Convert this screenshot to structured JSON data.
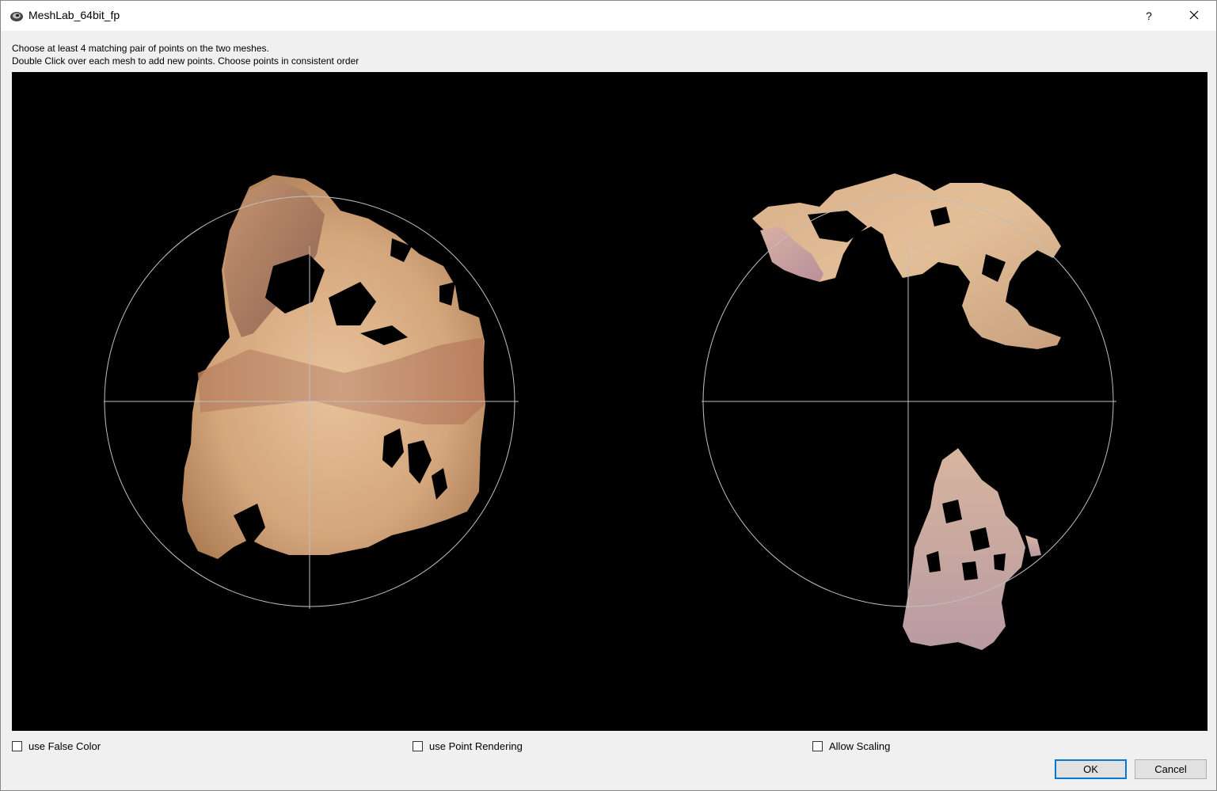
{
  "window": {
    "title": "MeshLab_64bit_fp",
    "help_label": "?"
  },
  "instructions": {
    "line1": "Choose at least 4 matching pair of points on the two meshes.",
    "line2": "Double Click over each mesh to add new points. Choose points in consistent order"
  },
  "options": {
    "false_color": "use False Color",
    "point_rendering": "use Point Rendering",
    "allow_scaling": "Allow Scaling"
  },
  "buttons": {
    "ok": "OK",
    "cancel": "Cancel"
  },
  "colors": {
    "viewport_bg": "#000000",
    "mesh_light": "#e2b991",
    "mesh_dark": "#9a6a4a",
    "mesh_pink": "#c8a0a8",
    "trackball": "#bfbfbf",
    "accent": "#0078d7"
  },
  "icons": {
    "app": "meshlab-logo-icon",
    "close": "close-icon"
  }
}
